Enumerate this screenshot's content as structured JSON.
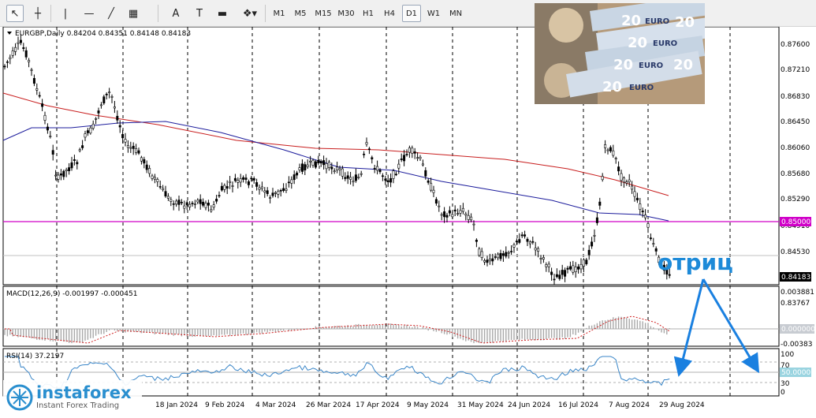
{
  "toolbar": {
    "tools": [
      {
        "name": "cursor-icon",
        "glyph": "↖"
      },
      {
        "name": "crosshair-icon",
        "glyph": "┼"
      },
      {
        "name": "vertical-line-icon",
        "glyph": "|"
      },
      {
        "name": "horizontal-line-icon",
        "glyph": "—"
      },
      {
        "name": "trendline-icon",
        "glyph": "╱"
      },
      {
        "name": "fibonacci-icon",
        "glyph": "▦"
      },
      {
        "name": "text-tool-icon",
        "glyph": "A"
      },
      {
        "name": "text-label-icon",
        "glyph": "T"
      },
      {
        "name": "rectangle-icon",
        "glyph": "▬"
      },
      {
        "name": "shapes-menu-icon",
        "glyph": "❖▾"
      }
    ],
    "timeframes": [
      "M1",
      "M5",
      "M15",
      "M30",
      "H1",
      "H4",
      "D1",
      "W1",
      "MN"
    ],
    "active_timeframe": "D1"
  },
  "main": {
    "symbol_info": "EURGBP,Daily  0.84204 0.84351 0.84148 0.84183",
    "price_labels": [
      "0.87600",
      "0.87210",
      "0.86830",
      "0.86450",
      "0.86060",
      "0.85680",
      "0.85290",
      "0.84910",
      "0.84530",
      "0.83767"
    ],
    "level_tag": "0.85000",
    "current_price_tag": "0.84183",
    "annotation": "отриц"
  },
  "photo": {
    "banknote_text": [
      "20",
      "EURO",
      "20",
      "EURO",
      "20",
      "EURO",
      "20",
      "EURO",
      "20",
      "20"
    ]
  },
  "macd": {
    "label": "MACD(12,26,9) -0.001997 -0.000451",
    "scale": [
      "0.003881",
      "0.000000",
      "-0.00383"
    ]
  },
  "rsi": {
    "label": "RSI(14) 37.2197",
    "scale": [
      "100",
      "70",
      "30",
      "0"
    ],
    "level_tag": "50.0000"
  },
  "date_labels": [
    "18 Jan 2024",
    "9 Feb 2024",
    "4 Mar 2024",
    "26 Mar 2024",
    "17 Apr 2024",
    "9 May 2024",
    "31 May 2024",
    "24 Jun 2024",
    "16 Jul 2024",
    "7 Aug 2024",
    "29 Aug 2024"
  ],
  "logo": {
    "name": "instaforex",
    "tagline": "Instant Forex Trading"
  },
  "colors": {
    "ma_slow": "#c81e1e",
    "ma_fast": "#1c1c9c",
    "level_line": "#d000c8",
    "macd_hist": "#a8a8a8",
    "macd_signal": "#d02020",
    "rsi_line": "#3a86c8",
    "annotation": "#1d8ad8",
    "arrows": "#1a80e0"
  }
}
